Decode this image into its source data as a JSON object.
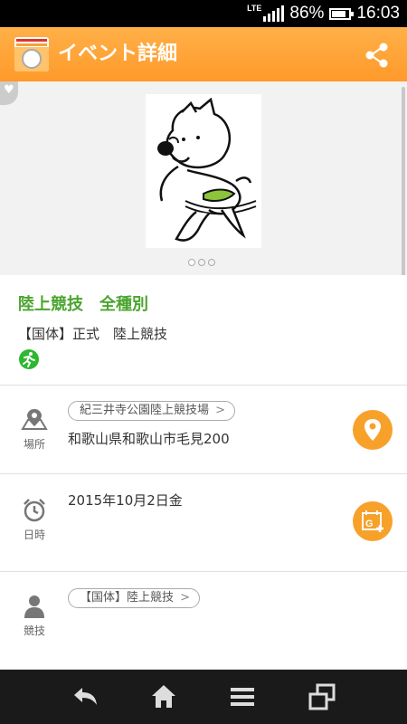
{
  "status_bar": {
    "network": "LTE",
    "battery_percent": "86%",
    "battery_level": 0.86,
    "time": "16:03"
  },
  "app_bar": {
    "title": "イベント詳細",
    "share_icon": "share-icon"
  },
  "gallery": {
    "page_count": 3,
    "current_page": 1
  },
  "event": {
    "name": "陸上競技　全種別",
    "category": "【国体】正式　陸上競技",
    "badge_color": "#2db82f"
  },
  "location": {
    "label": "場所",
    "venue": "紀三井寺公園陸上競技場",
    "address": "和歌山県和歌山市毛見200"
  },
  "datetime": {
    "label": "日時",
    "date": "2015年10月2日金"
  },
  "competition": {
    "label": "競技",
    "chip": "【国体】陸上競技"
  },
  "colors": {
    "accent": "#ff9a2a",
    "action_button": "#f7a12a",
    "event_name": "#4aa52e"
  }
}
